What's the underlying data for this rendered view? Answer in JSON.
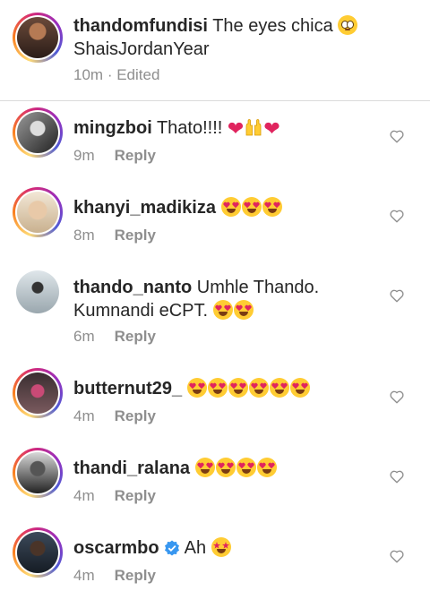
{
  "caption": {
    "username": "thandomfundisi",
    "text_line1": "The eyes chica",
    "text_line2": "ShaisJordanYear",
    "time": "10m",
    "edited": "Edited"
  },
  "reply_label": "Reply",
  "comments": [
    {
      "username": "mingzboi",
      "text": "Thato!!!!",
      "emojis": [
        "red-heart",
        "raising-hands",
        "red-heart"
      ],
      "time": "9m"
    },
    {
      "username": "khanyi_madikiza",
      "text": "",
      "emojis": [
        "heart-eyes",
        "heart-eyes",
        "heart-eyes"
      ],
      "time": "8m"
    },
    {
      "username": "thando_nanto",
      "text": "Umhle Thando.",
      "text2": "Kumnandi eCPT.",
      "emojis": [
        "heart-eyes",
        "heart-eyes"
      ],
      "time": "6m"
    },
    {
      "username": "butternut29_",
      "text": "",
      "emojis": [
        "heart-eyes",
        "heart-eyes",
        "heart-eyes",
        "heart-eyes",
        "heart-eyes",
        "heart-eyes"
      ],
      "time": "4m"
    },
    {
      "username": "thandi_ralana",
      "text": "",
      "emojis": [
        "heart-eyes",
        "heart-eyes",
        "heart-eyes",
        "heart-eyes"
      ],
      "time": "4m"
    },
    {
      "username": "oscarmbo",
      "verified": true,
      "text": "Ah",
      "emojis": [
        "star-struck"
      ],
      "time": "4m"
    }
  ],
  "colors": {
    "text": "#262626",
    "muted": "#8e8e8e",
    "verified": "#3897f0",
    "heart": "#e0245e"
  }
}
